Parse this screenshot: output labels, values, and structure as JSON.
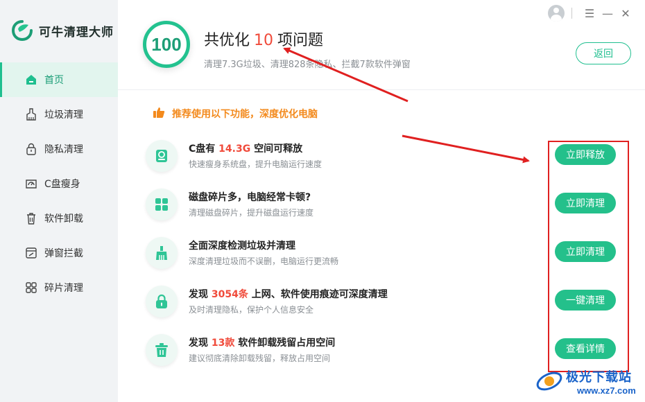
{
  "app": {
    "name": "可牛清理大师",
    "accent_color": "#24c08b",
    "highlight_color": "#f04a3a"
  },
  "sidebar": {
    "items": [
      {
        "label": "首页",
        "icon": "home-icon",
        "active": true
      },
      {
        "label": "垃圾清理",
        "icon": "broom-icon",
        "active": false
      },
      {
        "label": "隐私清理",
        "icon": "lock-icon",
        "active": false
      },
      {
        "label": "C盘瘦身",
        "icon": "disk-icon",
        "active": false
      },
      {
        "label": "软件卸载",
        "icon": "trash-icon",
        "active": false
      },
      {
        "label": "弹窗拦截",
        "icon": "popup-block-icon",
        "active": false
      },
      {
        "label": "碎片清理",
        "icon": "grid-icon",
        "active": false
      }
    ]
  },
  "header": {
    "score": "100",
    "title_prefix": "共优化",
    "title_count": "10",
    "title_suffix": "项问题",
    "subtitle": "清理7.3G垃圾、清理828条隐私、拦截7款软件弹窗",
    "back_label": "返回"
  },
  "window_controls": {
    "icons": [
      "avatar-icon",
      "menu-icon",
      "minimize-icon",
      "close-icon"
    ],
    "menu": "☰",
    "minimize": "—",
    "close": "✕"
  },
  "recommend": {
    "text": "推荐使用以下功能，深度优化电脑",
    "icon": "thumbs-up-icon"
  },
  "items": [
    {
      "title_pre": "C盘有 ",
      "title_hl": "14.3G",
      "title_post": " 空间可释放",
      "desc": "快速瘦身系统盘，提升电脑运行速度",
      "button": "立即释放",
      "icon": "disk-icon"
    },
    {
      "title_pre": "磁盘碎片多，电脑经常卡顿?",
      "title_hl": "",
      "title_post": "",
      "desc": "清理磁盘碎片，提升磁盘运行速度",
      "button": "立即清理",
      "icon": "grid-icon"
    },
    {
      "title_pre": "全面深度检测垃圾并清理",
      "title_hl": "",
      "title_post": "",
      "desc": "深度清理垃圾而不误删，电脑运行更流畅",
      "button": "立即清理",
      "icon": "broom-icon"
    },
    {
      "title_pre": "发现 ",
      "title_hl": "3054条",
      "title_post": " 上网、软件使用痕迹可深度清理",
      "desc": "及时清理隐私，保护个人信息安全",
      "button": "一键清理",
      "icon": "lock-icon"
    },
    {
      "title_pre": "发现 ",
      "title_hl": "13款",
      "title_post": " 软件卸载残留占用空间",
      "desc": "建议彻底清除卸载残留，释放占用空间",
      "button": "查看详情",
      "icon": "trash-icon"
    }
  ],
  "watermark": {
    "text": "极光下载站",
    "url": "www.xz7.com"
  }
}
